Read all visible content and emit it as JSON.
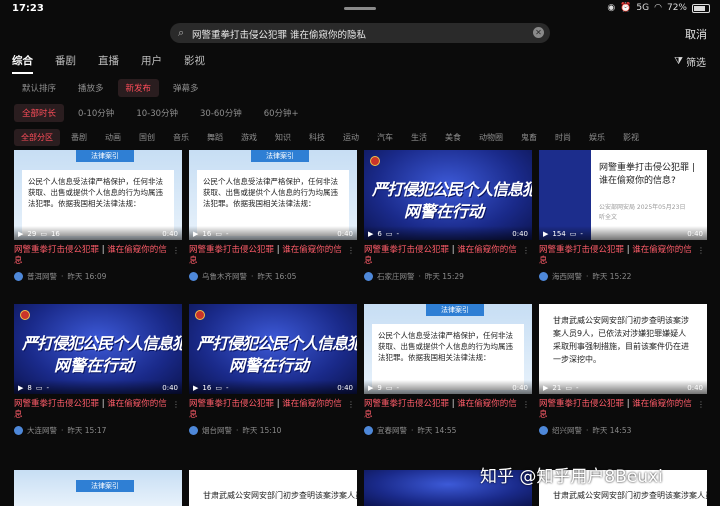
{
  "status": {
    "time": "17:23",
    "battery": "72%",
    "signal": "5G"
  },
  "search": {
    "query": "网警重拳打击侵公犯罪 谁在偷窥你的隐私",
    "cancel": "取消"
  },
  "tabs": [
    "综合",
    "番剧",
    "直播",
    "用户",
    "影视"
  ],
  "filter_label": "筛选",
  "sort_chips": [
    "默认排序",
    "播放多",
    "新发布",
    "弹幕多"
  ],
  "duration_chips": [
    "全部时长",
    "0-10分钟",
    "10-30分钟",
    "30-60分钟",
    "60分钟+"
  ],
  "category_chips": [
    "全部分区",
    "番剧",
    "动画",
    "国创",
    "音乐",
    "舞蹈",
    "游戏",
    "知识",
    "科技",
    "运动",
    "汽车",
    "生活",
    "美食",
    "动物圈",
    "鬼畜",
    "时尚",
    "娱乐",
    "影视"
  ],
  "colors": {
    "accent": "#ff4d5a",
    "background": "#0b0b0b"
  },
  "thumb_text": {
    "law_banner": "法律案引",
    "law_body": "公民个人信息受法律严格保护，任何非法获取、出售或提供个人信息的行为均属违法犯罪。依据我国相关法律法规：",
    "police_line1": "严打侵犯公民个人信息犯罪",
    "police_line2": "网警在行动",
    "article_title": "网警重拳打击侵公犯罪 | 谁在偷窥你的信息?",
    "article_meta": "公安部网安局 2025年05月23日",
    "article_meta2": "听全文",
    "notice_body": "甘肃武威公安网安部门初步查明该案涉案人员9人，已依法对涉嫌犯罪嫌疑人采取刑事强制措施，目前该案件仍在进一步深挖中。",
    "dark_body": "甘肃武威公安网安部门初步查明该案涉案人员9人"
  },
  "cards": [
    {
      "thumb": "law",
      "views": "29",
      "comments": "16",
      "duration": "0:40",
      "title_hl": "网警重拳打击侵公犯罪",
      "title_rest": "谁在偷窥你的信息",
      "author": "普洱网警",
      "time": "昨天 16:09"
    },
    {
      "thumb": "law",
      "views": "16",
      "comments": "-",
      "duration": "0:40",
      "title_hl": "网警重拳打击侵公犯罪",
      "title_rest": "谁在偷窥你的信息",
      "author": "乌鲁木齐网警",
      "time": "昨天 16:05"
    },
    {
      "thumb": "police",
      "views": "6",
      "comments": "-",
      "duration": "0:40",
      "title_hl": "网警重拳打击侵公犯罪",
      "title_rest": "谁在偷窥你的信息",
      "author": "石家庄网警",
      "time": "昨天 15:29"
    },
    {
      "thumb": "article",
      "views": "154",
      "comments": "-",
      "duration": "0:40",
      "title_hl": "网警重拳打击侵公犯罪",
      "title_rest": "谁在偷窥你的信息",
      "author": "海西网警",
      "time": "昨天 15:22"
    },
    {
      "thumb": "police",
      "views": "8",
      "comments": "-",
      "duration": "0:40",
      "title_hl": "网警重拳打击侵公犯罪",
      "title_rest": "谁在偷窥你的信息",
      "author": "大连网警",
      "time": "昨天 15:17"
    },
    {
      "thumb": "police",
      "views": "16",
      "comments": "-",
      "duration": "0:40",
      "title_hl": "网警重拳打击侵公犯罪",
      "title_rest": "谁在偷窥你的信息",
      "author": "烟台网警",
      "time": "昨天 15:10"
    },
    {
      "thumb": "law",
      "views": "9",
      "comments": "-",
      "duration": "0:40",
      "title_hl": "网警重拳打击侵公犯罪",
      "title_rest": "谁在偷窥你的信息",
      "author": "宜春网警",
      "time": "昨天 14:55"
    },
    {
      "thumb": "notice",
      "views": "21",
      "comments": "-",
      "duration": "0:40",
      "title_hl": "网警重拳打击侵公犯罪",
      "title_rest": "谁在偷窥你的信息",
      "author": "绍兴网警",
      "time": "昨天 14:53"
    }
  ],
  "watermark": "知乎 @知乎用户8Beuxi"
}
